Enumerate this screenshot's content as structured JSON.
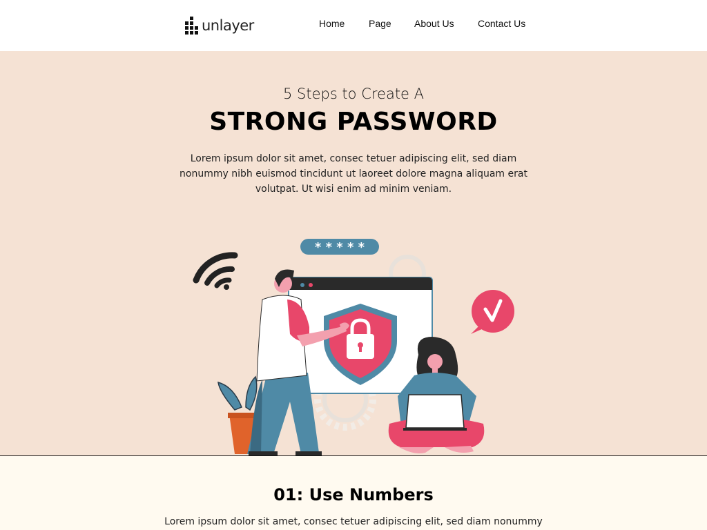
{
  "header": {
    "logo_text": "unlayer",
    "nav": [
      "Home",
      "Page",
      "About Us",
      "Contact Us"
    ]
  },
  "hero": {
    "subtitle": "5 Steps to Create A",
    "title": "STRONG PASSWORD",
    "text": "Lorem ipsum dolor sit amet, consec tetuer adipiscing elit, sed diam nonummy nibh euismod tincidunt ut laoreet dolore magna aliquam erat volutpat. Ut wisi enim ad minim veniam.",
    "password_mask": "* * * * *"
  },
  "step": {
    "title": "01: Use Numbers",
    "text": "Lorem ipsum dolor sit amet, consec tetuer adipiscing elit, sed diam nonummy"
  },
  "colors": {
    "hero_bg": "#f5e2d4",
    "section_bg": "#fffaf0",
    "accent_pink": "#e8476a",
    "accent_teal": "#4f8aa6"
  }
}
